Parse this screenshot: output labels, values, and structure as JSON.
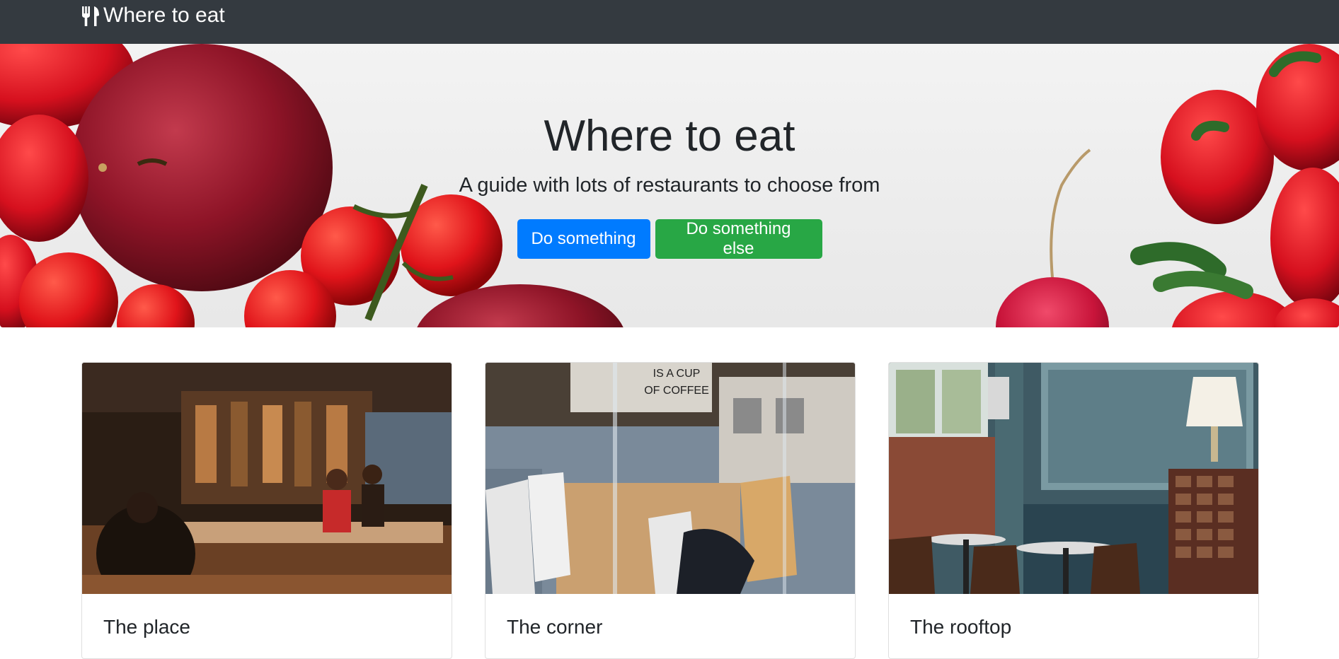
{
  "navbar": {
    "brand_icon": "utensils-icon",
    "brand_label": "Where to eat"
  },
  "hero": {
    "title": "Where to eat",
    "subtitle": "A guide with lots of restaurants to choose from",
    "primary_button": "Do something",
    "secondary_button": "Do something else"
  },
  "cards": [
    {
      "title": "The place"
    },
    {
      "title": "The corner"
    },
    {
      "title": "The rooftop"
    }
  ],
  "colors": {
    "navbar_bg": "#343a40",
    "primary": "#007bff",
    "success": "#28a745"
  }
}
